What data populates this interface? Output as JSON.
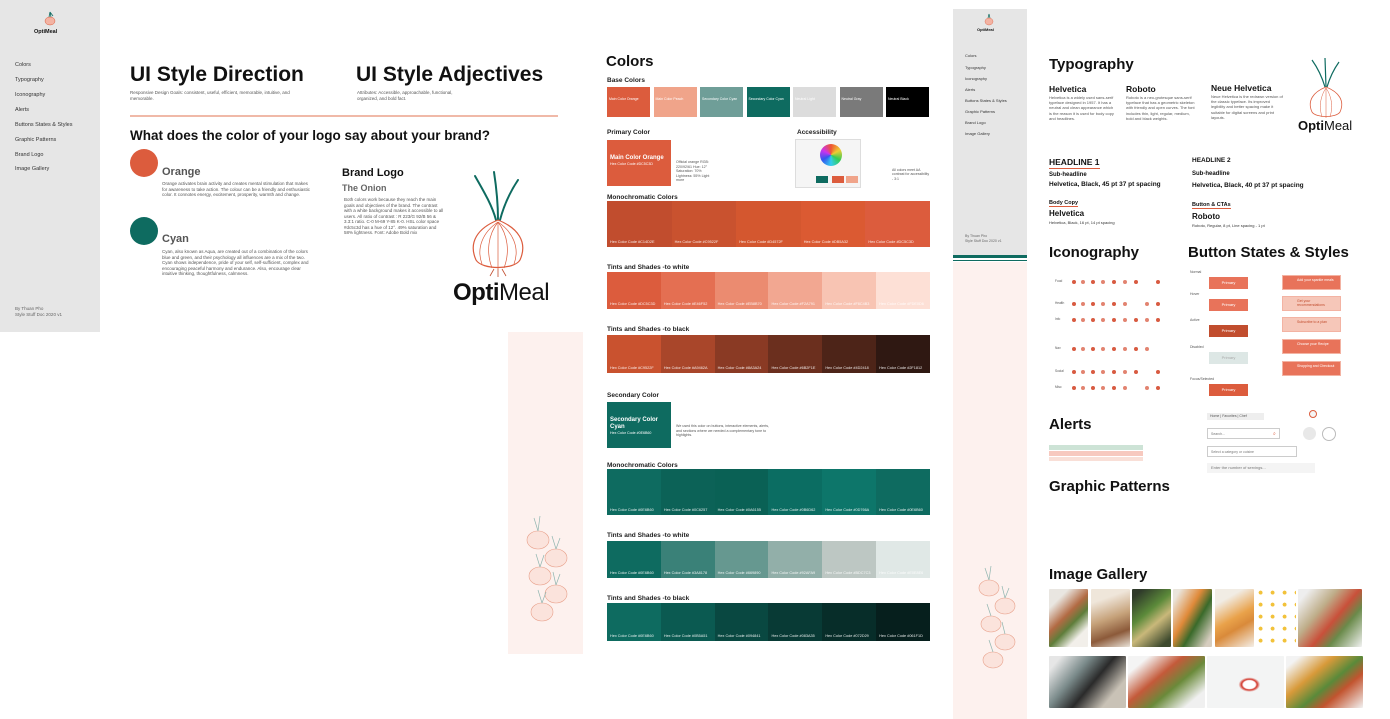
{
  "left_nav": {
    "logo_text": "OptiMeal",
    "items": [
      "Colors",
      "Typography",
      "Iconography",
      "Alerts",
      "Buttons States & Styles",
      "Graphic Patterns",
      "Brand Logo",
      "Image Gallery"
    ],
    "credit": [
      "By Thuan Pho",
      "Style Stuff Doc 2020 v1"
    ]
  },
  "direction": {
    "title": "UI Style Direction",
    "desc": "Responsive Design Goals: consistent, useful, efficient, memorable, intuitive, and memorable.",
    "adjectives_title": "UI Style Adjectives",
    "adjectives_desc": "Attributes: Accessible, approachable, functional, organized, and bold fact.",
    "question": "What does the color of your logo say about your brand?",
    "orange_label": "Orange",
    "orange_desc": "Orange activates brain activity and creates mental stimulation that makes for awareness to take action. The colour can be a friendly and enthusiastic color. It connotes energy, excitement, prosperity, warmth and change.",
    "cyan_label": "Cyan",
    "cyan_desc": "Cyan, also known as Aqua, are created out of a combination of the colors blue and green, and their psychology all influences are a mix of the two. Cyan shows independence, pride of your self, self-sufficient, complex and encouraging peaceful harmony and endurance. Also, encourage clear intuitive thinking, thoughtfulness, calmness.",
    "brand_logo_title": "Brand Logo",
    "brand_logo_sub": "The Onion",
    "brand_logo_desc": "Both colors work because they reach the main goals and objectives of the brand. The contrast with a white background makes it accessible to all users. All ratio of contrast : R 223/G 92/B 56 & 3.3:1 ratio. C-0 M-69 Y-85 K-0. HSL color space #dc5c3d has a hue of 12°. 49% saturation and 58% lightness. Font: Adobe Bold mix",
    "logo_text_1": "Opti",
    "logo_text_2": "Meal"
  },
  "colors": {
    "title": "Colors",
    "base_title": "Base Colors",
    "base": [
      {
        "label": "Main Color Orange",
        "hex": "#dc5c3d"
      },
      {
        "label": "Main Color Peach",
        "hex": "#f0a48a"
      },
      {
        "label": "Secondary Color Cyan",
        "hex": "#6f9e98"
      },
      {
        "label": "Secondary Color Cyan",
        "hex": "#0e6b60"
      },
      {
        "label": "Neutral Light",
        "hex": "#dcdcdc"
      },
      {
        "label": "Neutral Gray",
        "hex": "#7a7a7a"
      },
      {
        "label": "Neutral Black",
        "hex": "#000000"
      }
    ],
    "primary_title": "Primary Color",
    "primary_swatch_label": "Main Color Orange",
    "primary_swatch_hex": "Hex Color Code #DC5C3D",
    "primary_info": "Official orange RGB: 220/92/61 Hue: 12° Saturation: 70% Lightness: 55% Light more",
    "accessibility_title": "Accessibility",
    "accessibility_note": "All colors meet AA contrast for accessibility - 3:1",
    "mono_title": "Monochromatic Colors",
    "mono_orange": [
      "Hex Color Code #C14D2E",
      "Hex Color Code #C9522F",
      "Hex Color Code #D4572F",
      "Hex Color Code #DB5A32",
      "Hex Color Code #DC5C3D"
    ],
    "tints_white_title": "Tints and Shades -to white",
    "tints_orange": [
      "Hex Color Code #DC5C3D",
      "Hex Color Code #E46F52",
      "Hex Color Code #EB8B70",
      "Hex Color Code #F2A791",
      "Hex Color Code #F8C4B3",
      "Hex Color Code #FDE0D6"
    ],
    "shades_black_title": "Tints and Shades -to black",
    "shades_orange": [
      "Hex Color Code #C9522F",
      "Hex Color Code #A9462A",
      "Hex Color Code #8A3A24",
      "Hex Color Code #6B2F1E",
      "Hex Color Code #4D2418",
      "Hex Color Code #2F1812"
    ],
    "secondary_title": "Secondary Color",
    "secondary_swatch_label": "Secondary Color Cyan",
    "secondary_swatch_hex": "Hex Color Code #0E6B60",
    "secondary_info": "We used this color on buttons, interactive elements, alerts, and sections where we needed a complementary tone to highlights.",
    "mono_cyan_title": "Monochromatic Colors",
    "mono_cyan": [
      "Hex Color Code #0E6B60",
      "Hex Color Code #0C6257",
      "Hex Color Code #0A6155",
      "Hex Color Code #0B6D62",
      "Hex Color Code #0D766A",
      "Hex Color Code #0E6B60"
    ],
    "tints_cyan_title": "Tints and Shades -to white",
    "tints_cyan": [
      "Hex Color Code #0E6B60",
      "Hex Color Code #3A8178",
      "Hex Color Code #669890",
      "Hex Color Code #92AFA9",
      "Hex Color Code #BDC7C3",
      "Hex Color Code #E0E8E6"
    ],
    "shades_cyan_title": "Tints and Shades -to black",
    "shades_cyan": [
      "Hex Color Code #0E6B60",
      "Hex Color Code #0B5A51",
      "Hex Color Code #094841",
      "Hex Color Code #083A35",
      "Hex Color Code #072D29",
      "Hex Color Code #061F1D"
    ]
  },
  "right_nav": {
    "logo_text": "OptiMeal",
    "items": [
      "Colors",
      "Typography",
      "Iconography",
      "Alerts",
      "Buttons States & Styles",
      "Graphic Patterns",
      "Brand Logo",
      "Image Gallery"
    ],
    "credit": [
      "By Thuan Pho",
      "Style Stuff Doc 2020 v1"
    ]
  },
  "typography": {
    "title": "Typography",
    "fonts": [
      {
        "name": "Helvetica",
        "desc": "Helvetica is a widely used sans-serif typeface designed in 1957. It has a neutral and clean appearance which is the reason it is used for body copy and headlines."
      },
      {
        "name": "Roboto",
        "desc": "Roboto is a neo-grotesque sans-serif typeface that has a geometric skeleton with friendly and open curves. The font includes thin, light, regular, medium, bold and black weights."
      },
      {
        "name": "Neue Helvetica",
        "desc": "Neue Helvetica is the redrawn version of the classic typeface. Its improved legibility and better spacing make it suitable for digital screens and print layouts."
      }
    ],
    "headline1": "HEADLINE 1",
    "subheadline1": "Sub-headline",
    "spec1": "Helvetica, Black, 45 pt 37 pt spacing",
    "headline2": "HEADLINE 2",
    "subheadline2": "Sub-headline",
    "spec2": "Helvetica, Black, 40 pt 37 pt spacing",
    "body_label": "Body Copy",
    "body_font": "Helvetica",
    "body_spec": "Helvetica, Black, 16 pt, 14 pt spacing",
    "button_label": "Button & CTAs",
    "button_font": "Roboto",
    "button_spec": "Roboto, Regular, 8 pt, Line spacing - 1 pt"
  },
  "iconography": {
    "title": "Iconography",
    "row_labels": [
      "Food",
      "Health",
      "Info",
      "Nav",
      "Social",
      "Misc"
    ]
  },
  "button_states": {
    "title": "Button States & Styles",
    "states": [
      {
        "label": "Normal",
        "text": "Primary"
      },
      {
        "label": "Hover",
        "text": "Primary"
      },
      {
        "label": "Active",
        "text": "Primary"
      },
      {
        "label": "Disabled",
        "text": "Primary"
      },
      {
        "label": "Focus/Selected",
        "text": "Primary"
      }
    ],
    "cards": [
      "Add your sparkle meals",
      "Get your recommendations",
      "Subscribe to a plan",
      "Choose your Recipe",
      "Shopping and Checkout"
    ],
    "search_tabs": "Home | Favorites | Chef",
    "search_placeholder": "Search...",
    "select_placeholder": "Select a category or cuisine",
    "input_placeholder": "Enter the number of servings..."
  },
  "alerts": {
    "title": "Alerts"
  },
  "graphic_patterns": {
    "title": "Graphic Patterns"
  },
  "image_gallery": {
    "title": "Image Gallery"
  },
  "colors_palette": {
    "orange": "#dc5c3d",
    "teal": "#0e6b60",
    "peach_bg": "#fdf1ee"
  }
}
